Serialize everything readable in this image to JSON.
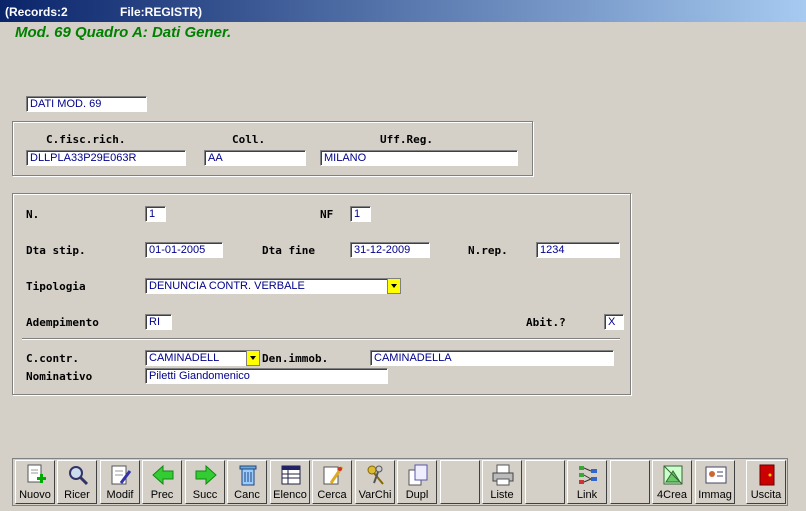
{
  "window": {
    "records": "(Records:2",
    "file": "File:REGISTR)"
  },
  "heading": "Mod. 69 Quadro A: Dati Gener.",
  "section_label": "DATI MOD. 69",
  "top": {
    "labels": {
      "cfisc": "C.fisc.rich.",
      "coll": "Coll.",
      "uff": "Uff.Reg."
    },
    "values": {
      "cfisc": "DLLPLA33P29E063R",
      "coll": "AA",
      "uff": "MILANO"
    }
  },
  "main": {
    "labels": {
      "n": "N.",
      "nf": "NF",
      "dta_stip": "Dta stip.",
      "dta_fine": "Dta fine",
      "nrep": "N.rep.",
      "tipologia": "Tipologia",
      "adempimento": "Adempimento",
      "abit": "Abit.?",
      "ccontr": "C.contr.",
      "denimmob": "Den.immob.",
      "nominativo": "Nominativo"
    },
    "values": {
      "n": "1",
      "nf": "1",
      "dta_stip": "01-01-2005",
      "dta_fine": "31-12-2009",
      "nrep": "1234",
      "tipologia": "DENUNCIA CONTR. VERBALE",
      "adempimento": "RI",
      "abit": "X",
      "ccontr": "CAMINADELL",
      "denimmob": "CAMINADELLA",
      "nominativo": "Piletti Giandomenico"
    }
  },
  "toolbar": [
    {
      "label": "Nuovo",
      "icon": "new-record-icon"
    },
    {
      "label": "Ricer",
      "icon": "search-icon"
    },
    {
      "label": "Modif",
      "icon": "edit-icon"
    },
    {
      "label": "Prec",
      "icon": "arrow-left-icon"
    },
    {
      "label": "Succ",
      "icon": "arrow-right-icon"
    },
    {
      "label": "Canc",
      "icon": "trash-icon"
    },
    {
      "label": "Elenco",
      "icon": "list-icon"
    },
    {
      "label": "Cerca",
      "icon": "find-icon"
    },
    {
      "label": "VarChi",
      "icon": "keys-icon"
    },
    {
      "label": "Dupl",
      "icon": "duplicate-icon"
    },
    {
      "label": "",
      "icon": ""
    },
    {
      "label": "Liste",
      "icon": "printer-icon"
    },
    {
      "label": "",
      "icon": ""
    },
    {
      "label": "Link",
      "icon": "link-icon"
    },
    {
      "label": "",
      "icon": ""
    },
    {
      "label": "4Crea",
      "icon": "create-icon"
    },
    {
      "label": "Immag",
      "icon": "image-icon"
    },
    {
      "label": "Uscita",
      "icon": "exit-door-icon"
    }
  ],
  "colors": {
    "heading": "#008000",
    "field_text": "#00008b",
    "dropdown_button": "#ffff00",
    "titlebar": "#0a246a"
  }
}
